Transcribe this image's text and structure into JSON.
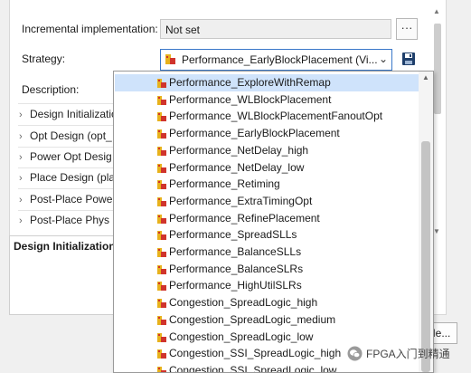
{
  "settings": {
    "incremental_label": "Incremental implementation:",
    "incremental_value": "Not set",
    "more_button": "···",
    "strategy_label": "Strategy:",
    "strategy_value": "Performance_EarlyBlockPlacement (Vi...",
    "description_label": "Description:"
  },
  "tree": {
    "items": [
      {
        "label": "Design Initializatio"
      },
      {
        "label": "Opt Design (opt_"
      },
      {
        "label": "Power Opt Desig"
      },
      {
        "label": "Place Design (pla"
      },
      {
        "label": "Post-Place Powe"
      },
      {
        "label": "Post-Place Phys"
      }
    ],
    "expand_glyph": "›"
  },
  "description_panel": {
    "title": "Design Initialization"
  },
  "bottom_button": "He...",
  "dropdown": {
    "selected_index": 0,
    "items": [
      "Performance_ExploreWithRemap",
      "Performance_WLBlockPlacement",
      "Performance_WLBlockPlacementFanoutOpt",
      "Performance_EarlyBlockPlacement",
      "Performance_NetDelay_high",
      "Performance_NetDelay_low",
      "Performance_Retiming",
      "Performance_ExtraTimingOpt",
      "Performance_RefinePlacement",
      "Performance_SpreadSLLs",
      "Performance_BalanceSLLs",
      "Performance_BalanceSLRs",
      "Performance_HighUtilSLRs",
      "Congestion_SpreadLogic_high",
      "Congestion_SpreadLogic_medium",
      "Congestion_SpreadLogic_low",
      "Congestion_SSI_SpreadLogic_high",
      "Congestion_SSI_SpreadLogic_low"
    ]
  },
  "watermark": {
    "text": "FPGA入门到精通"
  },
  "colors": {
    "selection": "#cfe3fb",
    "focus_border": "#3a78c9",
    "strategy_icon_red": "#d0342c",
    "strategy_icon_gold": "#e8b21c",
    "save_icon": "#1f3f6b"
  },
  "icons": {
    "strategy": "strategy-icon",
    "save": "save-icon",
    "dropdown_chevron": "chevron-down-icon",
    "scroll_up": "scroll-up-arrow-icon",
    "wechat": "wechat-icon"
  }
}
